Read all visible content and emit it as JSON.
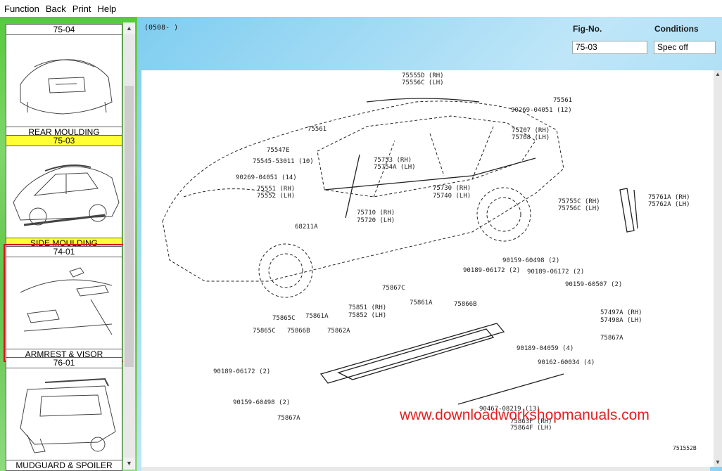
{
  "menu": {
    "items": [
      "Function",
      "Back",
      "Print",
      "Help"
    ]
  },
  "thumbnails": [
    {
      "code": "75-04",
      "label": "REAR MOULDING",
      "selected": false,
      "focused": false
    },
    {
      "code": "75-03",
      "label": "SIDE MOULDING",
      "selected": true,
      "focused": false
    },
    {
      "code": "74-01",
      "label": "ARMREST & VISOR",
      "selected": false,
      "focused": true
    },
    {
      "code": "76-01",
      "label": "MUDGUARD & SPOILER",
      "selected": false,
      "focused": false
    }
  ],
  "header": {
    "code_text": "(0508-      )",
    "fig_no_label": "Fig-No.",
    "conditions_label": "Conditions",
    "fig_no_value": "75-03",
    "conditions_value": "Spec off"
  },
  "diagram": {
    "parts": [
      "75555D (RH)",
      "75556C (LH)",
      "75561",
      "90269-04051 (12)",
      "75561",
      "75707 (RH)",
      "75708 (LH)",
      "75547E",
      "75545-53011 (10)",
      "90269-04051 (14)",
      "75753 (RH)",
      "75754A (LH)",
      "75551 (RH)",
      "75552 (LH)",
      "75730 (RH)",
      "75740 (LH)",
      "75755C (RH)",
      "75756C (LH)",
      "75761A (RH)",
      "75762A (LH)",
      "75710 (RH)",
      "75720 (LH)",
      "68211A",
      "90159-60498 (2)",
      "90189-06172 (2)",
      "90189-06172 (2)",
      "90159-60507 (2)",
      "75867C",
      "75866B",
      "75861A",
      "57497A (RH)",
      "57498A (LH)",
      "75865C",
      "75861A",
      "75851 (RH)",
      "75852 (LH)",
      "75865C",
      "75866B",
      "75862A",
      "75867A",
      "90189-04059 (4)",
      "90162-60034 (4)",
      "90189-06172 (2)",
      "90159-60498 (2)",
      "90467-08219 (13)",
      "75863F (RH)",
      "75864F (LH)",
      "75867A"
    ],
    "watermark": "www.downloadworkshopmanuals.com",
    "figure_id": "751552B"
  }
}
